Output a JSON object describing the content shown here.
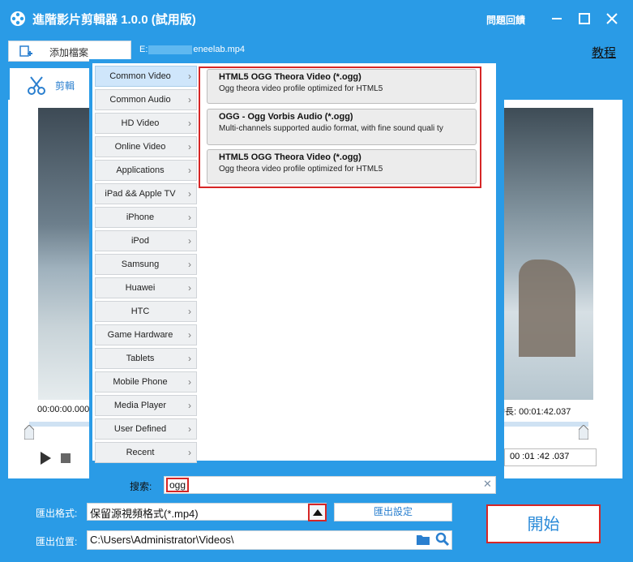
{
  "app": {
    "title": "進階影片剪輯器 1.0.0 (試用版)",
    "feedback_label": "問題回饋"
  },
  "toolbar": {
    "add_file_label": "添加檔案",
    "filename_prefix": "E:",
    "filename_suffix": "eneelab.mp4",
    "tutorial_label": "教程"
  },
  "tabs": {
    "edit_label": "剪輯"
  },
  "player": {
    "time_start": "00:00:00.000",
    "duration_label": "時長: ",
    "duration_value": "00:01:42.037",
    "end_time": "00 :01 :42 .037"
  },
  "popup": {
    "categories": [
      {
        "label": "Common Video",
        "selected": true
      },
      {
        "label": "Common Audio"
      },
      {
        "label": "HD Video"
      },
      {
        "label": "Online Video"
      },
      {
        "label": "Applications"
      },
      {
        "label": "iPad && Apple TV"
      },
      {
        "label": "iPhone"
      },
      {
        "label": "iPod"
      },
      {
        "label": "Samsung"
      },
      {
        "label": "Huawei"
      },
      {
        "label": "HTC"
      },
      {
        "label": "Game Hardware"
      },
      {
        "label": "Tablets"
      },
      {
        "label": "Mobile Phone"
      },
      {
        "label": "Media Player"
      },
      {
        "label": "User Defined"
      },
      {
        "label": "Recent"
      }
    ],
    "formats": [
      {
        "title": "HTML5 OGG Theora Video (*.ogg)",
        "desc": "Ogg theora video profile optimized for HTML5"
      },
      {
        "title": "OGG - Ogg Vorbis Audio (*.ogg)",
        "desc": "Multi-channels supported audio format, with fine sound quali ty"
      },
      {
        "title": "HTML5 OGG Theora Video (*.ogg)",
        "desc": "Ogg theora video profile optimized for HTML5"
      }
    ],
    "search_label": "搜索:",
    "search_value": "ogg"
  },
  "output": {
    "format_label": "匯出格式:",
    "format_value": "保留源視頻格式(*.mp4)",
    "settings_label": "匯出設定",
    "location_label": "匯出位置:",
    "location_value": "C:\\Users\\Administrator\\Videos\\",
    "start_label": "開始"
  },
  "colors": {
    "accent": "#2a9be6",
    "highlight": "#d62626"
  }
}
